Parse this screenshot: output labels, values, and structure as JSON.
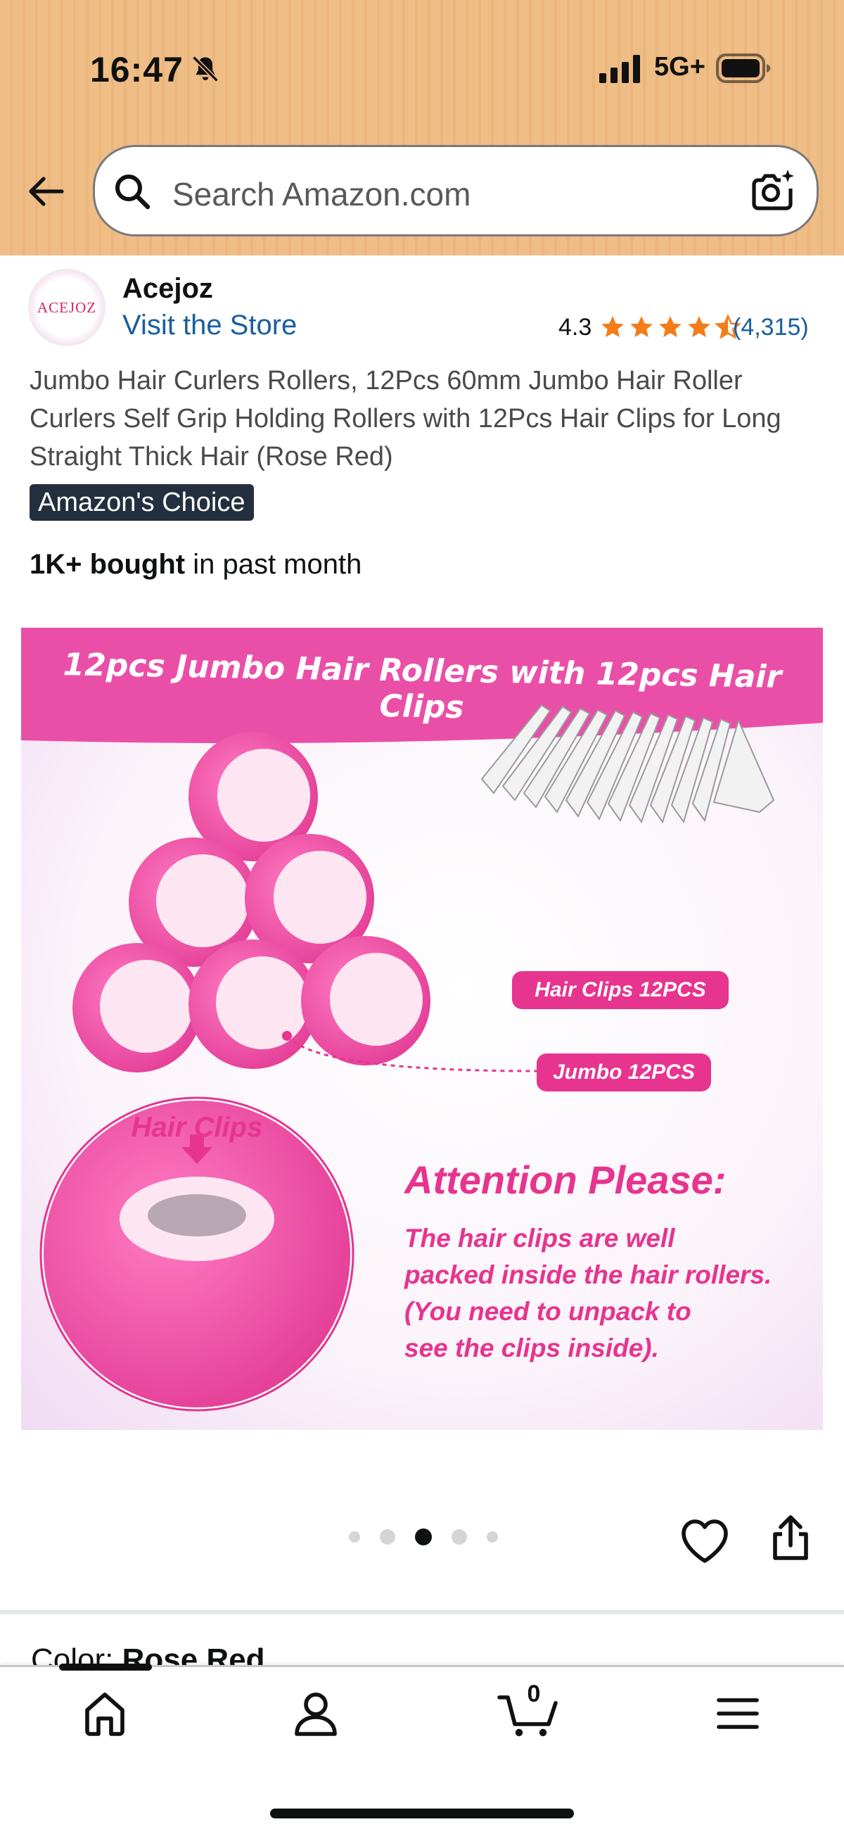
{
  "status_bar": {
    "time": "16:47",
    "network": "5G+"
  },
  "search": {
    "placeholder": "Search Amazon.com"
  },
  "brand": {
    "logo_text": "ACEJOZ",
    "name": "Acejoz",
    "visit_store": "Visit the Store"
  },
  "rating": {
    "value": "4.3",
    "count": "(4,315)",
    "stars_filled_fraction": 0.86
  },
  "product": {
    "title": "Jumbo Hair Curlers Rollers, 12Pcs 60mm Jumbo Hair Roller Curlers Self Grip Holding Rollers with 12Pcs Hair Clips for Long Straight Thick Hair (Rose Red)",
    "badge": "Amazon's Choice",
    "bought_bold": "1K+ bought",
    "bought_rest": " in past month"
  },
  "image_text": {
    "banner": "12pcs Jumbo Hair Rollers with 12pcs Hair Clips",
    "hair_clips_label": "Hair Clips 12PCS",
    "jumbo_label": "Jumbo 12PCS",
    "circle_label": "Hair Clips",
    "attention_title": "Attention Please:",
    "attention_line1": "The hair clips are well",
    "attention_line2": "packed inside the hair rollers.",
    "attention_line3": "(You need to unpack to",
    "attention_line4": "see the clips inside)."
  },
  "carousel": {
    "total_dots": 5,
    "active_index": 2
  },
  "variation": {
    "label": "Color: ",
    "value": "Rose Red"
  },
  "bottom_nav": {
    "cart_count": "0"
  },
  "colors": {
    "header": "#efbd86",
    "link": "#1a5ea0",
    "star": "#f47c19",
    "badge_bg": "#232f3e",
    "pink": "#ee3fa0"
  },
  "icons": [
    "back-arrow-icon",
    "search-icon",
    "camera-icon",
    "bell-off-icon",
    "signal-icon",
    "battery-icon",
    "star-icon",
    "heart-icon",
    "share-icon",
    "home-icon",
    "account-icon",
    "cart-icon",
    "menu-icon"
  ]
}
